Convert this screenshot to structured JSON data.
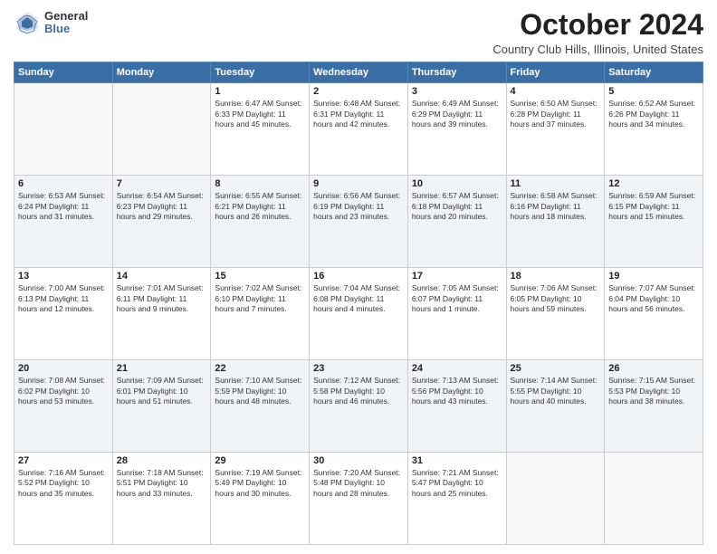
{
  "logo": {
    "general": "General",
    "blue": "Blue"
  },
  "title": "October 2024",
  "subtitle": "Country Club Hills, Illinois, United States",
  "days_of_week": [
    "Sunday",
    "Monday",
    "Tuesday",
    "Wednesday",
    "Thursday",
    "Friday",
    "Saturday"
  ],
  "weeks": [
    [
      {
        "day": "",
        "info": ""
      },
      {
        "day": "",
        "info": ""
      },
      {
        "day": "1",
        "info": "Sunrise: 6:47 AM\nSunset: 6:33 PM\nDaylight: 11 hours and 45 minutes."
      },
      {
        "day": "2",
        "info": "Sunrise: 6:48 AM\nSunset: 6:31 PM\nDaylight: 11 hours and 42 minutes."
      },
      {
        "day": "3",
        "info": "Sunrise: 6:49 AM\nSunset: 6:29 PM\nDaylight: 11 hours and 39 minutes."
      },
      {
        "day": "4",
        "info": "Sunrise: 6:50 AM\nSunset: 6:28 PM\nDaylight: 11 hours and 37 minutes."
      },
      {
        "day": "5",
        "info": "Sunrise: 6:52 AM\nSunset: 6:26 PM\nDaylight: 11 hours and 34 minutes."
      }
    ],
    [
      {
        "day": "6",
        "info": "Sunrise: 6:53 AM\nSunset: 6:24 PM\nDaylight: 11 hours and 31 minutes."
      },
      {
        "day": "7",
        "info": "Sunrise: 6:54 AM\nSunset: 6:23 PM\nDaylight: 11 hours and 29 minutes."
      },
      {
        "day": "8",
        "info": "Sunrise: 6:55 AM\nSunset: 6:21 PM\nDaylight: 11 hours and 26 minutes."
      },
      {
        "day": "9",
        "info": "Sunrise: 6:56 AM\nSunset: 6:19 PM\nDaylight: 11 hours and 23 minutes."
      },
      {
        "day": "10",
        "info": "Sunrise: 6:57 AM\nSunset: 6:18 PM\nDaylight: 11 hours and 20 minutes."
      },
      {
        "day": "11",
        "info": "Sunrise: 6:58 AM\nSunset: 6:16 PM\nDaylight: 11 hours and 18 minutes."
      },
      {
        "day": "12",
        "info": "Sunrise: 6:59 AM\nSunset: 6:15 PM\nDaylight: 11 hours and 15 minutes."
      }
    ],
    [
      {
        "day": "13",
        "info": "Sunrise: 7:00 AM\nSunset: 6:13 PM\nDaylight: 11 hours and 12 minutes."
      },
      {
        "day": "14",
        "info": "Sunrise: 7:01 AM\nSunset: 6:11 PM\nDaylight: 11 hours and 9 minutes."
      },
      {
        "day": "15",
        "info": "Sunrise: 7:02 AM\nSunset: 6:10 PM\nDaylight: 11 hours and 7 minutes."
      },
      {
        "day": "16",
        "info": "Sunrise: 7:04 AM\nSunset: 6:08 PM\nDaylight: 11 hours and 4 minutes."
      },
      {
        "day": "17",
        "info": "Sunrise: 7:05 AM\nSunset: 6:07 PM\nDaylight: 11 hours and 1 minute."
      },
      {
        "day": "18",
        "info": "Sunrise: 7:06 AM\nSunset: 6:05 PM\nDaylight: 10 hours and 59 minutes."
      },
      {
        "day": "19",
        "info": "Sunrise: 7:07 AM\nSunset: 6:04 PM\nDaylight: 10 hours and 56 minutes."
      }
    ],
    [
      {
        "day": "20",
        "info": "Sunrise: 7:08 AM\nSunset: 6:02 PM\nDaylight: 10 hours and 53 minutes."
      },
      {
        "day": "21",
        "info": "Sunrise: 7:09 AM\nSunset: 6:01 PM\nDaylight: 10 hours and 51 minutes."
      },
      {
        "day": "22",
        "info": "Sunrise: 7:10 AM\nSunset: 5:59 PM\nDaylight: 10 hours and 48 minutes."
      },
      {
        "day": "23",
        "info": "Sunrise: 7:12 AM\nSunset: 5:58 PM\nDaylight: 10 hours and 46 minutes."
      },
      {
        "day": "24",
        "info": "Sunrise: 7:13 AM\nSunset: 5:56 PM\nDaylight: 10 hours and 43 minutes."
      },
      {
        "day": "25",
        "info": "Sunrise: 7:14 AM\nSunset: 5:55 PM\nDaylight: 10 hours and 40 minutes."
      },
      {
        "day": "26",
        "info": "Sunrise: 7:15 AM\nSunset: 5:53 PM\nDaylight: 10 hours and 38 minutes."
      }
    ],
    [
      {
        "day": "27",
        "info": "Sunrise: 7:16 AM\nSunset: 5:52 PM\nDaylight: 10 hours and 35 minutes."
      },
      {
        "day": "28",
        "info": "Sunrise: 7:18 AM\nSunset: 5:51 PM\nDaylight: 10 hours and 33 minutes."
      },
      {
        "day": "29",
        "info": "Sunrise: 7:19 AM\nSunset: 5:49 PM\nDaylight: 10 hours and 30 minutes."
      },
      {
        "day": "30",
        "info": "Sunrise: 7:20 AM\nSunset: 5:48 PM\nDaylight: 10 hours and 28 minutes."
      },
      {
        "day": "31",
        "info": "Sunrise: 7:21 AM\nSunset: 5:47 PM\nDaylight: 10 hours and 25 minutes."
      },
      {
        "day": "",
        "info": ""
      },
      {
        "day": "",
        "info": ""
      }
    ]
  ]
}
